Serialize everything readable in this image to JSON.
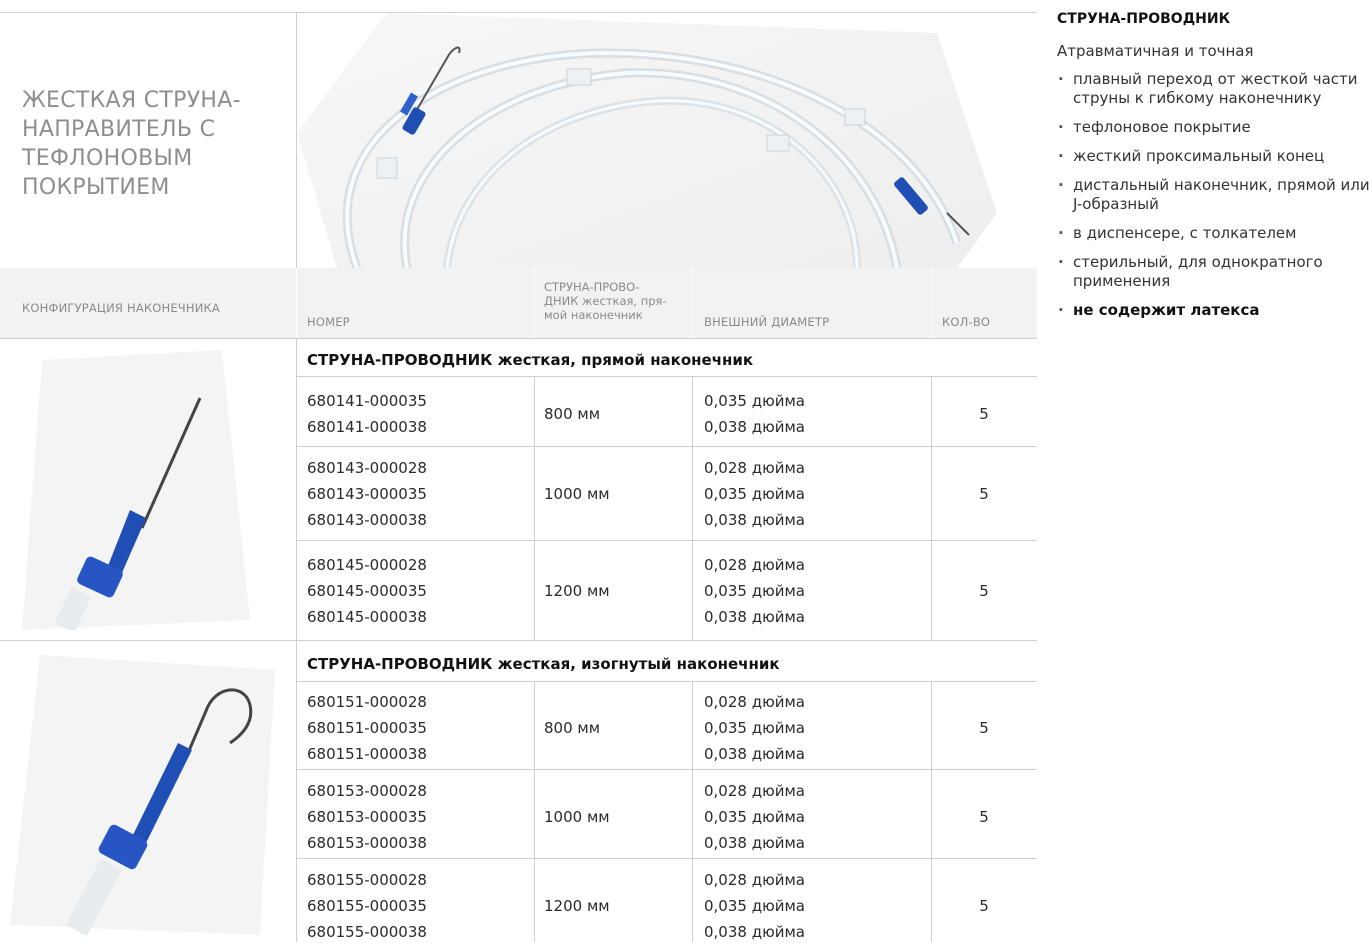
{
  "page_title": "ЖЕСТКАЯ СТРУНА-НАПРАВИТЕЛЬ С ТЕФЛОНОВЫМ ПОКРЫТИЕМ",
  "hero_image": "guidewire-coil-photo",
  "columns": {
    "config": "КОНФИГУРАЦИЯ НАКОНЕЧНИКА",
    "number": "НОМЕР",
    "length_head": "СТРУНА-ПРОВО-",
    "length_sub1": "ДНИК жесткая, пря-",
    "length_sub2": "мой наконечник",
    "diameter": "ВНЕШНИЙ ДИАМЕТР",
    "qty": "КОЛ-ВО"
  },
  "groups": [
    {
      "title": "СТРУНА-ПРОВОДНИК жесткая, прямой наконечник",
      "image": "straight-tip-photo",
      "rows": [
        {
          "numbers": [
            "680141-000035",
            "680141-000038"
          ],
          "length": "800 мм",
          "diameters": [
            "0,035 дюйма",
            "0,038 дюйма"
          ],
          "qty": "5"
        },
        {
          "numbers": [
            "680143-000028",
            "680143-000035",
            "680143-000038"
          ],
          "length": "1000 мм",
          "diameters": [
            "0,028 дюйма",
            "0,035 дюйма",
            "0,038 дюйма"
          ],
          "qty": "5"
        },
        {
          "numbers": [
            "680145-000028",
            "680145-000035",
            "680145-000038"
          ],
          "length": "1200 мм",
          "diameters": [
            "0,028 дюйма",
            "0,035 дюйма",
            "0,038 дюйма"
          ],
          "qty": "5"
        }
      ]
    },
    {
      "title": "СТРУНА-ПРОВОДНИК жесткая, изогнутый наконечник",
      "image": "j-tip-photo",
      "rows": [
        {
          "numbers": [
            "680151-000028",
            "680151-000035",
            "680151-000038"
          ],
          "length": "800 мм",
          "diameters": [
            "0,028 дюйма",
            "0,035 дюйма",
            "0,038 дюйма"
          ],
          "qty": "5"
        },
        {
          "numbers": [
            "680153-000028",
            "680153-000035",
            "680153-000038"
          ],
          "length": "1000 мм",
          "diameters": [
            "0,028 дюйма",
            "0,035 дюйма",
            "0,038 дюйма"
          ],
          "qty": "5"
        },
        {
          "numbers": [
            "680155-000028",
            "680155-000035",
            "680155-000038"
          ],
          "length": "1200 мм",
          "diameters": [
            "0,028 дюйма",
            "0,035 дюйма",
            "0,038 дюйма"
          ],
          "qty": "5"
        }
      ]
    }
  ],
  "side": {
    "title": "СТРУНА-ПРОВОДНИК",
    "subtitle": "Атравматичная и точная",
    "features": [
      "плавный переход от жесткой части струны к гибкому наконечнику",
      "тефлоновое покрытие",
      "жесткий проксимальный конец",
      "дистальный наконечник, прямой или J-образный",
      "в диспенсере, с толкателем",
      "стерильный, для однократного применения"
    ],
    "feature_strong": "не содержит латекса"
  },
  "colors": {
    "accent_blue": "#1f4fb5",
    "rule_gray": "#cfcfcf",
    "header_bg": "#f2f2f2",
    "title_gray": "#8e8e8e"
  }
}
